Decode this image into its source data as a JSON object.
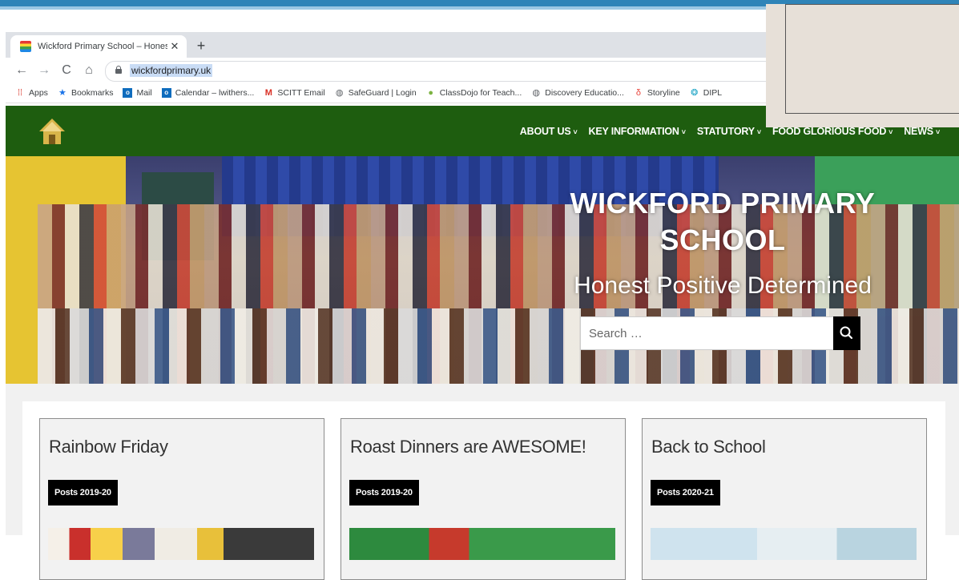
{
  "browser": {
    "tab_title": "Wickford Primary School – Honest",
    "url": "wickfordprimary.uk",
    "new_tab": "+",
    "close": "✕"
  },
  "bookmarks": [
    {
      "label": "Apps",
      "icon": "apps-grid-icon"
    },
    {
      "label": "Bookmarks",
      "icon": "star-icon"
    },
    {
      "label": "Mail",
      "icon": "outlook-icon"
    },
    {
      "label": "Calendar – lwithers...",
      "icon": "outlook-icon"
    },
    {
      "label": "SCITT Email",
      "icon": "gmail-icon"
    },
    {
      "label": "SafeGuard | Login",
      "icon": "globe-icon"
    },
    {
      "label": "ClassDojo for Teach...",
      "icon": "classdojo-icon"
    },
    {
      "label": "Discovery Educatio...",
      "icon": "globe-icon"
    },
    {
      "label": "Storyline",
      "icon": "storyline-icon"
    },
    {
      "label": "DIPL",
      "icon": "dipl-icon"
    }
  ],
  "site": {
    "menu": [
      "ABOUT US",
      "KEY INFORMATION",
      "STATUTORY",
      "FOOD GLORIOUS FOOD",
      "NEWS"
    ],
    "hero_title": "WICKFORD PRIMARY SCHOOL",
    "hero_tagline": "Honest Positive Determined",
    "search_placeholder": "Search …"
  },
  "cards": [
    {
      "title": "Rainbow Friday",
      "badge": "Posts 2019-20"
    },
    {
      "title": "Roast Dinners are AWESOME!",
      "badge": "Posts 2019-20"
    },
    {
      "title": "Back to School",
      "badge": "Posts 2020-21"
    }
  ],
  "colors": {
    "nav_green": "#1e5d0f",
    "badge_black": "#000000",
    "top_strip_blue": "#2f84b8"
  }
}
